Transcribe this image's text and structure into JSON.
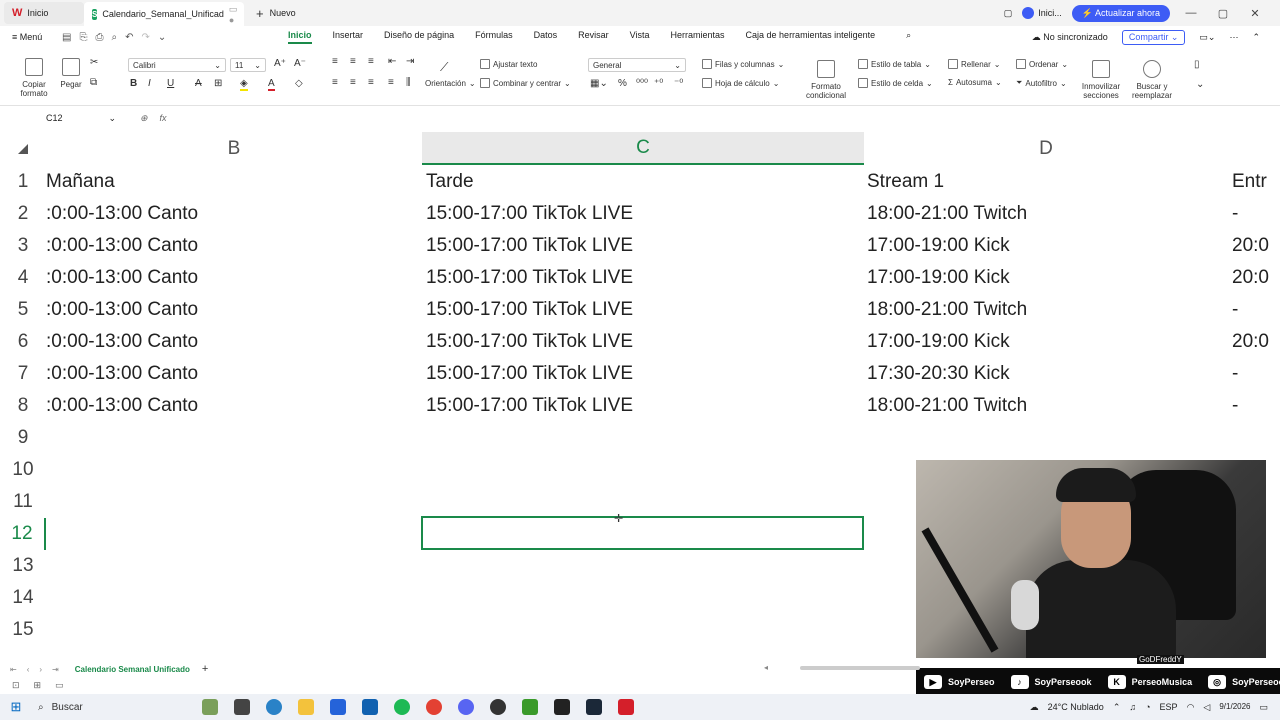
{
  "window": {
    "home_tab": "Inicio",
    "doc_tab": "Calendario_Semanal_Unificad",
    "new_tab": "Nuevo",
    "account": "Inici...",
    "upgrade": "Actualizar ahora"
  },
  "menubar": {
    "menu": "Menú",
    "tabs": [
      "Inicio",
      "Insertar",
      "Diseño de página",
      "Fórmulas",
      "Datos",
      "Revisar",
      "Vista",
      "Herramientas",
      "Caja de herramientas inteligente"
    ],
    "active_tab": "Inicio",
    "sync_status": "No sincronizado",
    "share": "Compartir"
  },
  "ribbon": {
    "copy_format": "Copiar formato",
    "paste": "Pegar",
    "font": "Calibri",
    "font_size": "11",
    "wrap_text": "Ajustar texto",
    "orientation": "Orientación",
    "merge_center": "Combinar y centrar",
    "number_format": "General",
    "rows_cols": "Filas y columnas",
    "worksheet": "Hoja de cálculo",
    "cond_format": "Formato condicional",
    "table_style": "Estilo de tabla",
    "cell_style": "Estilo de celda",
    "fill": "Rellenar",
    "autosum": "Autosuma",
    "sort": "Ordenar",
    "autofilter": "Autofiltro",
    "freeze": "Inmovilizar secciones",
    "find_replace": "Buscar y reemplazar"
  },
  "formula_bar": {
    "cell_ref": "C12",
    "fx": "fx",
    "value": ""
  },
  "grid": {
    "selected_col": "C",
    "selected_row": "12",
    "columns": [
      "B",
      "C",
      "D"
    ],
    "row_numbers": [
      "1",
      "2",
      "3",
      "4",
      "5",
      "6",
      "7",
      "8",
      "9",
      "10",
      "11",
      "12",
      "13",
      "14",
      "15"
    ],
    "rows": [
      {
        "b": "Mañana",
        "c": "Tarde",
        "d": "Stream 1",
        "e": "Entr"
      },
      {
        "b": ":0:00-13:00 Canto",
        "c": "15:00-17:00 TikTok LIVE",
        "d": "18:00-21:00 Twitch",
        "e": "-"
      },
      {
        "b": ":0:00-13:00 Canto",
        "c": "15:00-17:00 TikTok LIVE",
        "d": "17:00-19:00 Kick",
        "e": "20:0"
      },
      {
        "b": ":0:00-13:00 Canto",
        "c": "15:00-17:00 TikTok LIVE",
        "d": "17:00-19:00 Kick",
        "e": "20:0"
      },
      {
        "b": ":0:00-13:00 Canto",
        "c": "15:00-17:00 TikTok LIVE",
        "d": "18:00-21:00 Twitch",
        "e": "-"
      },
      {
        "b": ":0:00-13:00 Canto",
        "c": "15:00-17:00 TikTok LIVE",
        "d": "17:00-19:00 Kick",
        "e": "20:0"
      },
      {
        "b": ":0:00-13:00 Canto",
        "c": "15:00-17:00 TikTok LIVE",
        "d": "17:30-20:30 Kick",
        "e": "-"
      },
      {
        "b": ":0:00-13:00 Canto",
        "c": "15:00-17:00 TikTok LIVE",
        "d": "18:00-21:00 Twitch",
        "e": "-"
      }
    ]
  },
  "sheet": {
    "tab": "Calendario Semanal Unificado"
  },
  "overlay": {
    "cam_label": "GoDFreddY",
    "socials": [
      {
        "icon": "youtube-icon",
        "glyph": "▶",
        "label": "SoyPerseo"
      },
      {
        "icon": "tiktok-icon",
        "glyph": "♪",
        "label": "SoyPerseook"
      },
      {
        "icon": "kick-icon",
        "glyph": "K",
        "label": "PerseoMusica"
      },
      {
        "icon": "instagram-icon",
        "glyph": "◎",
        "label": "SoyPerseook"
      }
    ]
  },
  "taskbar": {
    "search": "Buscar",
    "weather": "24°C Nublado",
    "lang": "ESP",
    "date": "9/1/2026"
  },
  "colors": {
    "accent": "#1a8a4a",
    "brand": "#d41f2a",
    "upgrade": "#3d5cf5"
  }
}
